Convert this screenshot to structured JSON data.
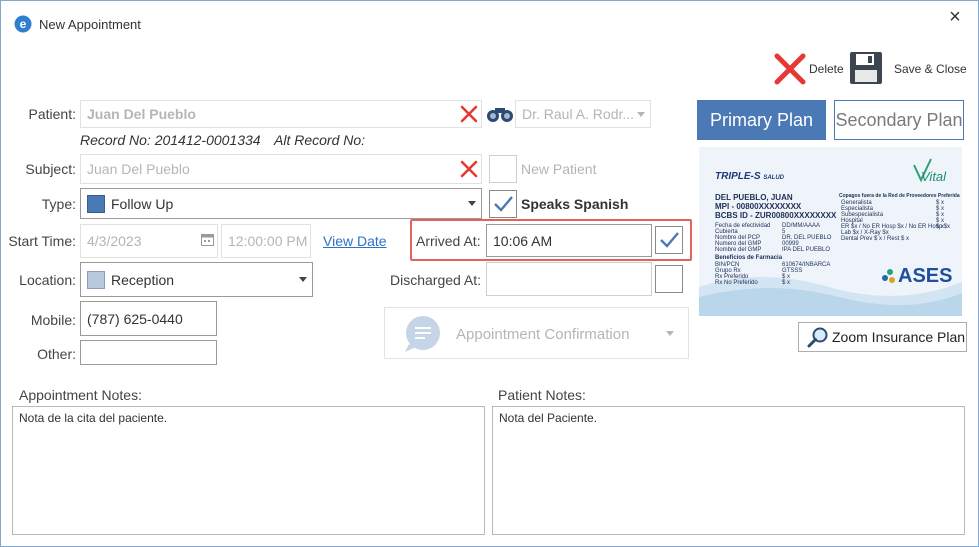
{
  "window": {
    "title": "New Appointment",
    "close_symbol": "×"
  },
  "toolbar": {
    "delete_label": "Delete",
    "save_close_label": "Save & Close"
  },
  "form": {
    "patient_label": "Patient:",
    "patient_value": "Juan Del Pueblo",
    "doctor_value": "Dr. Raul A. Rodr...",
    "record_no": "Record No: 201412-0001334",
    "alt_record_no": "Alt Record No:",
    "subject_label": "Subject:",
    "subject_value": "Juan Del Pueblo",
    "new_patient_label": "New Patient",
    "type_label": "Type:",
    "type_value": "Follow Up",
    "type_color": "#4a79b5",
    "speaks_spanish_label": "Speaks Spanish",
    "speaks_spanish_checked": true,
    "start_time_label": "Start Time:",
    "start_date_value": "4/3/2023",
    "start_time_value": "12:00:00 PM",
    "view_date_link": "View Date",
    "arrived_at_label": "Arrived At:",
    "arrived_at_value": "10:06 AM",
    "arrived_checked": true,
    "location_label": "Location:",
    "location_value": "Reception",
    "location_color": "#b7c9de",
    "discharged_at_label": "Discharged At:",
    "discharged_at_value": "",
    "mobile_label": "Mobile:",
    "mobile_value": "(787) 625-0440",
    "other_label": "Other:",
    "other_value": "",
    "appointment_confirmation_label": "Appointment Confirmation"
  },
  "plans": {
    "primary_label": "Primary Plan",
    "secondary_label": "Secondary Plan",
    "zoom_label": "Zoom Insurance Plan",
    "accent": "#4a79b5"
  },
  "insurance_card": {
    "brand": "TRIPLE-S",
    "brand_sub": "SALUD",
    "vital": "Vital",
    "member_name": "DEL PUEBLO, JUAN",
    "mpi": "MPI - 00800XXXXXXXX",
    "bcbs": "BCBS ID - ZUR00800XXXXXXXX",
    "left_rows": [
      [
        "Fecha de efectividad",
        "DD/MM/AAAA"
      ],
      [
        "Cubierta",
        "5"
      ],
      [
        "Nombre del PCP",
        "DR. DEL PUEBLO"
      ],
      [
        "Numero del GMP",
        "00999"
      ],
      [
        "Nombre del GMP",
        "IPA DEL PUEBLO"
      ]
    ],
    "pharmacy_title": "Beneficios de Farmacia",
    "pharmacy_rows": [
      [
        "BIN/PCN",
        "610674/INBARCA"
      ],
      [
        "Grupo Rx",
        "GTSSS"
      ],
      [
        "Rx Preferido",
        "$ x"
      ],
      [
        "Rx No Preferido",
        "$ x"
      ]
    ],
    "right_title": "Copagos fuera de la Red de Proveedores Preferida",
    "right_rows": [
      [
        "Generalista",
        "$ x"
      ],
      [
        "Especialista",
        "$ x"
      ],
      [
        "Subespecialista",
        "$ x"
      ],
      [
        "Hospital",
        "$ x"
      ],
      [
        "ER $x / No ER Hosp $x / No ER Hosp $x",
        "$ x"
      ],
      [
        "Lab $x / X-Ray $x",
        ""
      ],
      [
        "Dental Prev $ x / Rest $ x",
        ""
      ]
    ],
    "ases": "ASES"
  },
  "notes": {
    "appointment_label": "Appointment Notes:",
    "appointment_value": "Nota de la cita del paciente.",
    "patient_label": "Patient Notes:",
    "patient_value": "Nota del Paciente."
  },
  "colors": {
    "delete_red": "#e53935",
    "highlight": "#e0645a",
    "link": "#2a73c7"
  }
}
